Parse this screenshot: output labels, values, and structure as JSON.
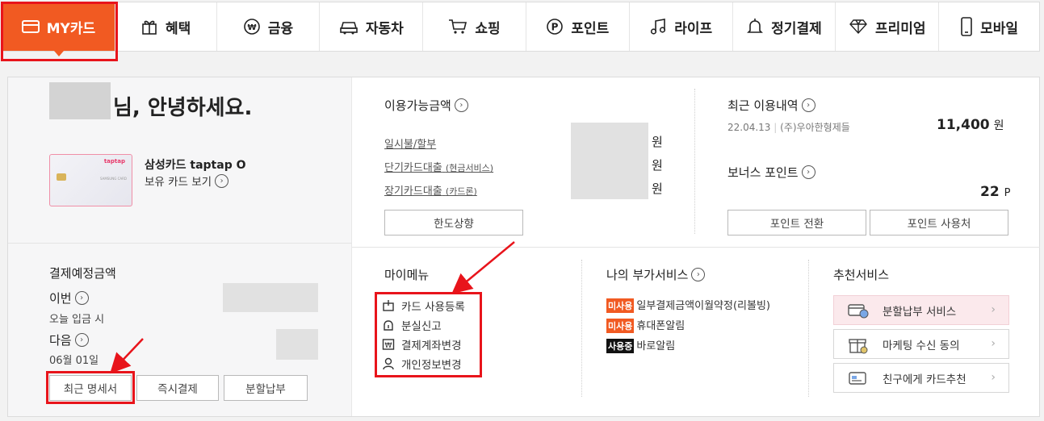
{
  "nav": [
    {
      "key": "my",
      "label": "MY카드",
      "icon": "card-icon"
    },
    {
      "key": "benefit",
      "label": "혜택",
      "icon": "gift-icon"
    },
    {
      "key": "finance",
      "label": "금융",
      "icon": "won-coin-icon"
    },
    {
      "key": "car",
      "label": "자동차",
      "icon": "car-icon"
    },
    {
      "key": "shopping",
      "label": "쇼핑",
      "icon": "cart-icon"
    },
    {
      "key": "point",
      "label": "포인트",
      "icon": "point-p-icon"
    },
    {
      "key": "life",
      "label": "라이프",
      "icon": "music-note-icon"
    },
    {
      "key": "autopay",
      "label": "정기결제",
      "icon": "bell-icon"
    },
    {
      "key": "premium",
      "label": "프리미엄",
      "icon": "diamond-icon"
    },
    {
      "key": "mobile",
      "label": "모바일",
      "icon": "mobile-icon"
    }
  ],
  "greeting": "님, 안녕하세요.",
  "card": {
    "name": "삼성카드 taptap O",
    "view_link": "보유 카드 보기",
    "logo_text": "taptap",
    "brand_text": "SAMSUNG CARD"
  },
  "payment": {
    "title": "결제예정금액",
    "this_label": "이번",
    "this_sub": "오늘 입금 시",
    "next_label": "다음",
    "next_sub": "06월 01일",
    "buttons": [
      "최근 명세서",
      "즉시결제",
      "분할납부"
    ]
  },
  "available": {
    "title": "이용가능금액",
    "rows": [
      {
        "label": "일시불/할부",
        "sub": "",
        "unit": "원"
      },
      {
        "label": "단기카드대출",
        "sub": "(현금서비스)",
        "unit": "원"
      },
      {
        "label": "장기카드대출",
        "sub": "(카드론)",
        "unit": "원"
      }
    ],
    "button": "한도상향"
  },
  "recent": {
    "title": "최근 이용내역",
    "date": "22.04.13",
    "merchant": "(주)우아한형제들",
    "amount": "11,400",
    "unit": "원"
  },
  "bonus": {
    "title": "보너스 포인트",
    "value": "22",
    "unit": "P",
    "buttons": [
      "포인트 전환",
      "포인트 사용처"
    ]
  },
  "mymenu": {
    "title": "마이메뉴",
    "items": [
      {
        "label": "카드 사용등록",
        "icon": "card-register-icon"
      },
      {
        "label": "분실신고",
        "icon": "siren-icon"
      },
      {
        "label": "결제계좌변경",
        "icon": "won-box-icon"
      },
      {
        "label": "개인정보변경",
        "icon": "person-icon"
      }
    ]
  },
  "addon": {
    "title": "나의 부가서비스",
    "items": [
      {
        "tag": "미사용",
        "tag_color": "#f15a22",
        "label": "일부결제금액이월약정(리볼빙)"
      },
      {
        "tag": "미사용",
        "tag_color": "#f15a22",
        "label": "휴대폰알림"
      },
      {
        "tag": "사용중",
        "tag_color": "#111111",
        "label": "바로알림"
      }
    ]
  },
  "recommend": {
    "title": "추천서비스",
    "items": [
      {
        "label": "분할납부 서비스",
        "icon": "card-chart-icon",
        "highlight": true
      },
      {
        "label": "마케팅 수신 동의",
        "icon": "gift-box-icon",
        "highlight": false
      },
      {
        "label": "친구에게 카드추천",
        "icon": "card-share-icon",
        "highlight": false
      }
    ]
  },
  "colors": {
    "accent": "#f15a22",
    "annotation_red": "#e8141b",
    "highlight_bg": "#fbe9ec"
  }
}
